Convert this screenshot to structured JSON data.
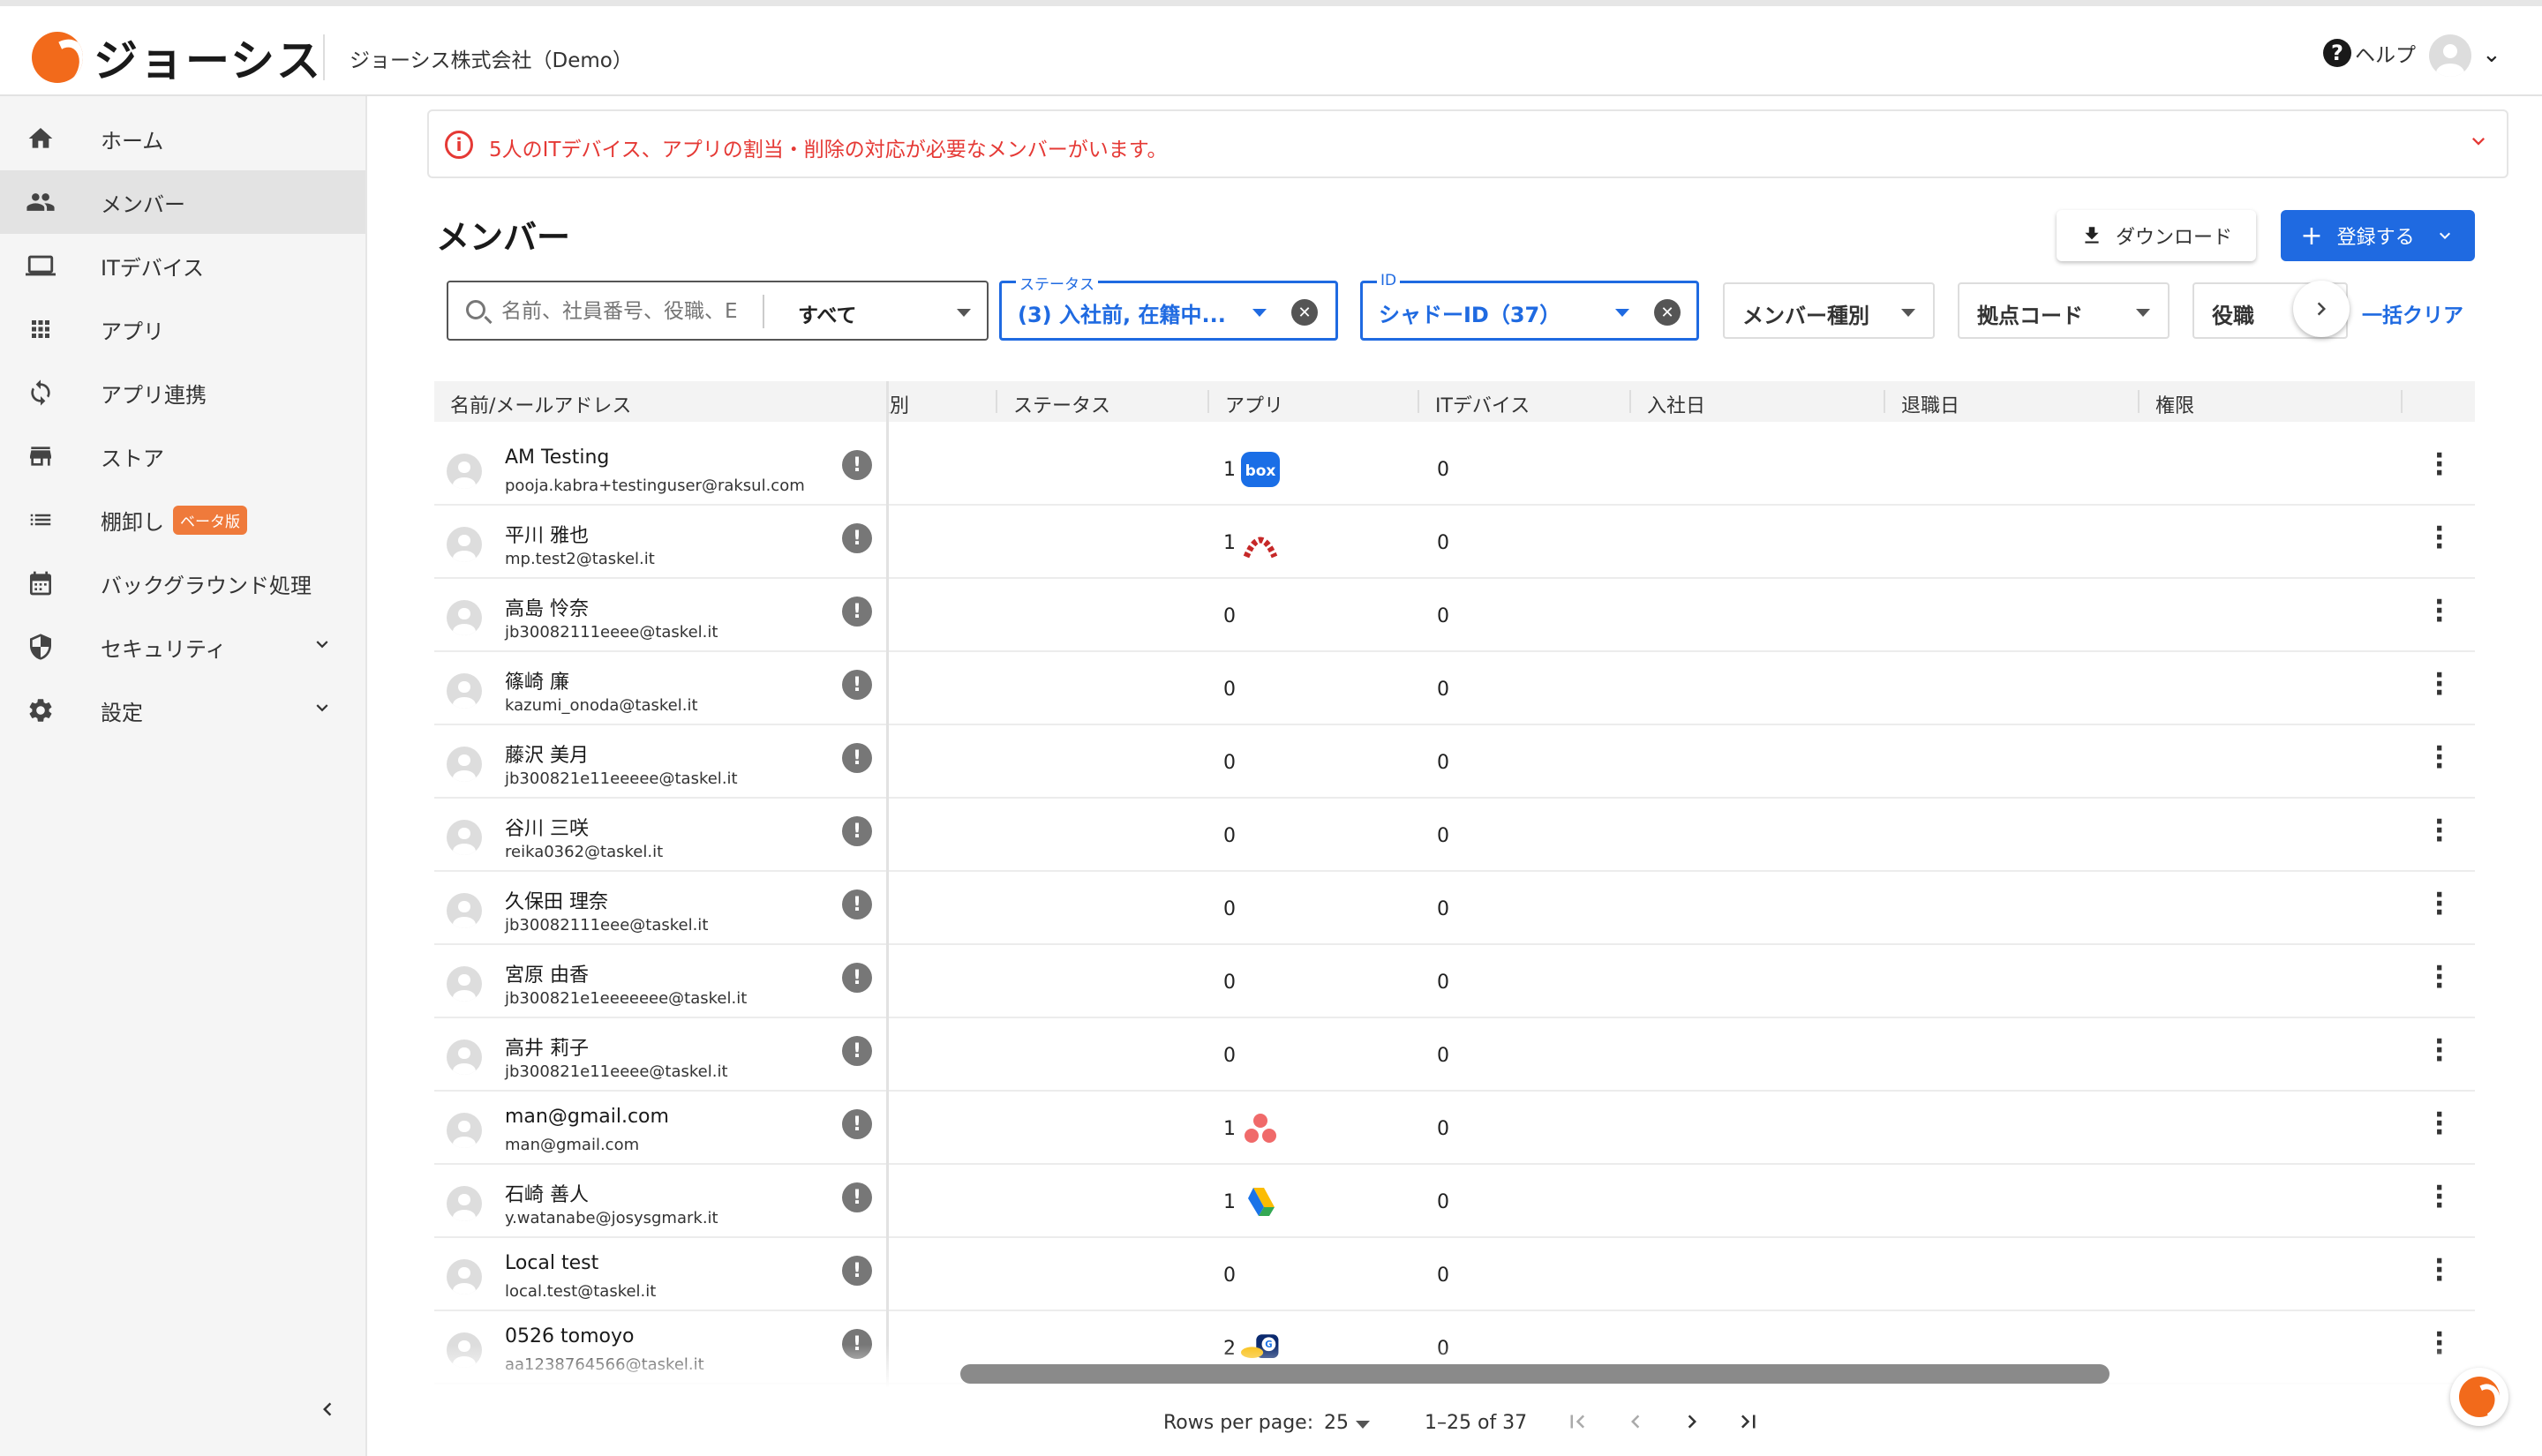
{
  "header": {
    "brand": "ジョーシス",
    "company": "ジョーシス株式会社（Demo）",
    "help": "ヘルプ"
  },
  "sidebar": {
    "items": [
      {
        "label": "ホーム",
        "icon": "home-icon"
      },
      {
        "label": "メンバー",
        "icon": "people-icon",
        "active": true
      },
      {
        "label": "ITデバイス",
        "icon": "laptop-icon"
      },
      {
        "label": "アプリ",
        "icon": "apps-grid-icon"
      },
      {
        "label": "アプリ連携",
        "icon": "sync-icon"
      },
      {
        "label": "ストア",
        "icon": "store-icon"
      },
      {
        "label": "棚卸し",
        "icon": "list-icon",
        "badge": "ベータ版"
      },
      {
        "label": "バックグラウンド処理",
        "icon": "calendar-icon"
      },
      {
        "label": "セキュリティ",
        "icon": "shield-icon",
        "expandable": true
      },
      {
        "label": "設定",
        "icon": "gear-icon",
        "expandable": true
      }
    ]
  },
  "alert": {
    "text": "5人のITデバイス、アプリの割当・削除の対応が必要なメンバーがいます。",
    "color": "#e53935"
  },
  "main": {
    "title": "メンバー",
    "download_label": "ダウンロード",
    "register_label": "登録する",
    "accent": "#1f6ae1"
  },
  "filters": {
    "search_placeholder": "名前、社員番号、役職、E",
    "search_scope": "すべて",
    "status_label": "ステータス",
    "status_value": "(3) 入社前, 在籍中...",
    "id_label": "ID",
    "id_value": "シャドーID（37）",
    "member_type": "メンバー種別",
    "location_code": "拠点コード",
    "position": "役職",
    "clear_all": "一括クリア"
  },
  "table": {
    "columns": {
      "name": "名前/メールアドレス",
      "type_partial": "種別",
      "status": "ステータス",
      "apps": "アプリ",
      "devices": "ITデバイス",
      "join": "入社日",
      "leave": "退職日",
      "perm": "権限"
    },
    "rows": [
      {
        "name": "AM Testing",
        "email": "pooja.kabra+testinguser@raksul.com",
        "apps": "1",
        "devices": "0",
        "app_icon": "box-icon"
      },
      {
        "name": "平川 雅也",
        "email": "mp.test2@taskel.it",
        "apps": "1",
        "devices": "0",
        "app_icon": "arch-icon"
      },
      {
        "name": "高島 怜奈",
        "email": "jb30082111eeee@taskel.it",
        "apps": "0",
        "devices": "0"
      },
      {
        "name": "篠崎 廉",
        "email": "kazumi_onoda@taskel.it",
        "apps": "0",
        "devices": "0"
      },
      {
        "name": "藤沢 美月",
        "email": "jb300821e11eeeee@taskel.it",
        "apps": "0",
        "devices": "0"
      },
      {
        "name": "谷川 三咲",
        "email": "reika0362@taskel.it",
        "apps": "0",
        "devices": "0"
      },
      {
        "name": "久保田 理奈",
        "email": "jb30082111eee@taskel.it",
        "apps": "0",
        "devices": "0"
      },
      {
        "name": "宮原 由香",
        "email": "jb300821e1eeeeeee@taskel.it",
        "apps": "0",
        "devices": "0"
      },
      {
        "name": "高井 莉子",
        "email": "jb300821e11eeee@taskel.it",
        "apps": "0",
        "devices": "0"
      },
      {
        "name": "man@gmail.com",
        "email": "man@gmail.com",
        "apps": "1",
        "devices": "0",
        "app_icon": "asana-icon"
      },
      {
        "name": "石崎 善人",
        "email": "y.watanabe@josysgmark.it",
        "apps": "1",
        "devices": "0",
        "app_icon": "google-drive-icon"
      },
      {
        "name": "Local test",
        "email": "local.test@taskel.it",
        "apps": "0",
        "devices": "0"
      },
      {
        "name": "0526 tomoyo",
        "email": "aa1238764566@taskel.it",
        "apps": "2",
        "devices": "0",
        "app_icon": "multi-app-icon"
      }
    ]
  },
  "pagination": {
    "rows_per_page_label": "Rows per page:",
    "rows_per_page": "25",
    "range": "1–25 of 37"
  }
}
